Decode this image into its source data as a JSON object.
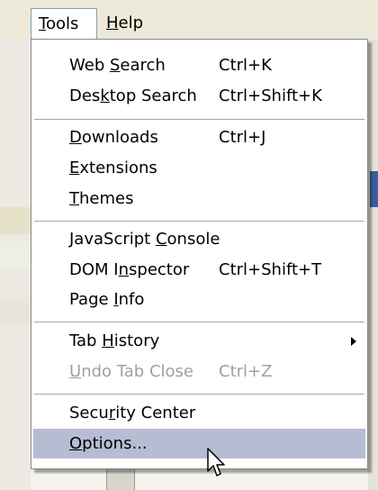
{
  "menubar": {
    "tools": {
      "pre": "",
      "acc": "T",
      "post": "ools"
    },
    "help": {
      "pre": "",
      "acc": "H",
      "post": "elp"
    }
  },
  "menu": {
    "web_search": {
      "pre": "Web ",
      "acc": "S",
      "post": "earch",
      "shortcut": "Ctrl+K"
    },
    "desktop_search": {
      "pre": "Des",
      "acc": "k",
      "post": "top Search",
      "shortcut": "Ctrl+Shift+K"
    },
    "downloads": {
      "pre": "",
      "acc": "D",
      "post": "ownloads",
      "shortcut": "Ctrl+J"
    },
    "extensions": {
      "pre": "",
      "acc": "E",
      "post": "xtensions"
    },
    "themes": {
      "pre": "",
      "acc": "T",
      "post": "hemes"
    },
    "js_console": {
      "pre": "JavaScript ",
      "acc": "C",
      "post": "onsole"
    },
    "dom_inspector": {
      "pre": "DOM I",
      "acc": "n",
      "post": "spector",
      "shortcut": "Ctrl+Shift+T"
    },
    "page_info": {
      "pre": "Page ",
      "acc": "I",
      "post": "nfo"
    },
    "tab_history": {
      "pre": "Tab ",
      "acc": "H",
      "post": "istory"
    },
    "undo_tab_close": {
      "pre": "",
      "acc": "U",
      "post": "ndo Tab Close",
      "shortcut": "Ctrl+Z"
    },
    "security_center": {
      "pre": "Secu",
      "acc": "r",
      "post": "ity Center"
    },
    "options": {
      "pre": "",
      "acc": "O",
      "post": "ptions..."
    }
  },
  "colors": {
    "highlight": "#b6bdd2",
    "disabled_text": "#a0a0a0",
    "menubar_bg": "#ece9d8"
  }
}
